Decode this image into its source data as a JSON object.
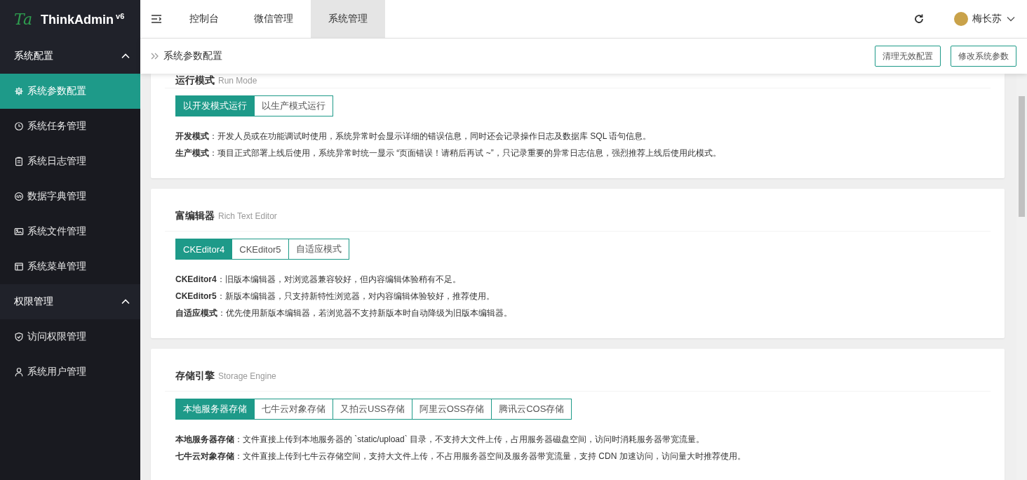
{
  "logo": {
    "mark": "Ta",
    "title": "ThinkAdmin$^{v6}$"
  },
  "sidebar": {
    "groups": [
      {
        "title": "系统配置",
        "expanded": true,
        "items": [
          {
            "label": "系统参数配置",
            "selected": true
          },
          {
            "label": "系统任务管理",
            "selected": false
          },
          {
            "label": "系统日志管理",
            "selected": false
          },
          {
            "label": "数据字典管理",
            "selected": false
          },
          {
            "label": "系统文件管理",
            "selected": false
          },
          {
            "label": "系统菜单管理",
            "selected": false
          }
        ]
      },
      {
        "title": "权限管理",
        "expanded": true,
        "items": [
          {
            "label": "访问权限管理",
            "selected": false
          },
          {
            "label": "系统用户管理",
            "selected": false
          }
        ]
      }
    ]
  },
  "top_tabs": [
    {
      "label": "控制台",
      "selected": false
    },
    {
      "label": "微信管理",
      "selected": false
    },
    {
      "label": "系统管理",
      "selected": true
    }
  ],
  "user": {
    "name": "梅长苏"
  },
  "breadcrumb": {
    "title": "系统参数配置"
  },
  "actions": [
    "清理无效配置",
    "修改系统参数"
  ],
  "sections": [
    {
      "title": "运行模式",
      "subtitle": "Run Mode",
      "options": [
        {
          "label": "以开发模式运行",
          "selected": true
        },
        {
          "label": "以生产模式运行",
          "selected": false
        }
      ],
      "notes": [
        "**开发模式**：开发人员或在功能调试时使用，系统异常时会显示详细的错误信息，同时还会记录操作日志及数据库 SQL 语句信息。",
        "**生产模式**：项目正式部署上线后使用，系统异常时统一显示 “页面错误！请稍后再试 ~”，只记录重要的异常日志信息，强烈推荐上线后使用此模式。"
      ]
    },
    {
      "title": "富编辑器",
      "subtitle": "Rich Text Editor",
      "options": [
        {
          "label": "CKEditor4",
          "selected": true
        },
        {
          "label": "CKEditor5",
          "selected": false
        },
        {
          "label": "自适应模式",
          "selected": false
        }
      ],
      "notes": [
        "**CKEditor4**：旧版本编辑器，对浏览器兼容较好，但内容编辑体验稍有不足。",
        "**CKEditor5**：新版本编辑器，只支持新特性浏览器，对内容编辑体验较好，推荐使用。",
        "**自适应模式**：优先使用新版本编辑器，若浏览器不支持新版本时自动降级为旧版本编辑器。"
      ]
    },
    {
      "title": "存储引擎",
      "subtitle": "Storage Engine",
      "options": [
        {
          "label": "本地服务器存储",
          "selected": true
        },
        {
          "label": "七牛云对象存储",
          "selected": false
        },
        {
          "label": "又拍云USS存储",
          "selected": false
        },
        {
          "label": "阿里云OSS存储",
          "selected": false
        },
        {
          "label": "腾讯云COS存储",
          "selected": false
        }
      ],
      "notes": [
        "**本地服务器存储**：文件直接上传到本地服务器的 `static/upload` 目录，不支持大文件上传，占用服务器磁盘空间，访问时消耗服务器带宽流量。",
        "**七牛云对象存储**：文件直接上传到七牛云存储空间，支持大文件上传，不占用服务器空间及服务器带宽流量，支持 CDN 加速访问，访问量大时推荐使用。"
      ]
    }
  ]
}
